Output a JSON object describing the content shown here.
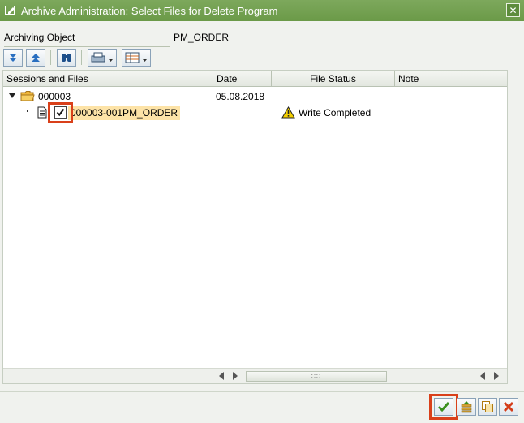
{
  "window": {
    "title": "Archive Administration: Select Files for Delete Program",
    "icons": {
      "window": "edit-window-icon",
      "close": "close-icon"
    }
  },
  "form": {
    "archiving_object_label": "Archiving Object",
    "archiving_object_value": "PM_ORDER"
  },
  "toolbar": {
    "buttons": [
      {
        "icon": "expand-all-icon"
      },
      {
        "icon": "collapse-all-icon"
      },
      {
        "icon": "find-icon"
      },
      {
        "icon": "print-icon"
      },
      {
        "icon": "layout-icon"
      }
    ]
  },
  "columns": [
    "Sessions and Files",
    "Date",
    "File Status",
    "Note"
  ],
  "tree": {
    "session": {
      "name": "000003",
      "date": "05.08.2018"
    },
    "file": {
      "name": "000003-001PM_ORDER",
      "status": "Write Completed",
      "checked": true
    }
  },
  "footer": {
    "buttons": [
      {
        "icon": "checkmark-icon"
      },
      {
        "icon": "select-all-icon"
      },
      {
        "icon": "copy-icon"
      },
      {
        "icon": "cancel-icon"
      }
    ]
  },
  "colors": {
    "titlebar": "#6b9a48",
    "selection": "#fde3a7",
    "highlight_box": "#d9401a",
    "folder": "#f0b73a",
    "warning": "#f4d000"
  }
}
